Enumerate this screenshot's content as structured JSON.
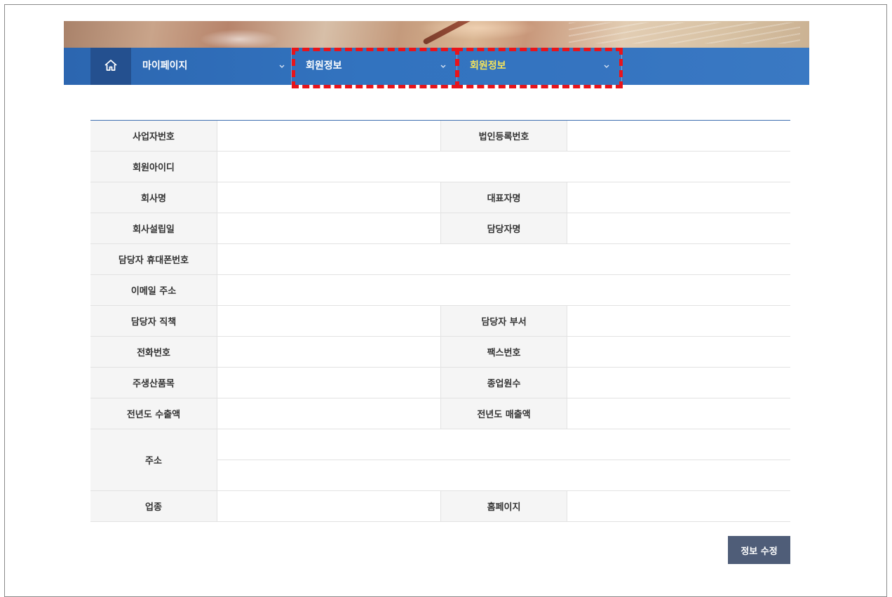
{
  "nav": {
    "home_icon": "home-icon",
    "items": [
      {
        "label": "마이페이지",
        "icon": "chevron-down-icon"
      },
      {
        "label": "회원정보",
        "icon": "chevron-down-icon"
      },
      {
        "label": "회원정보",
        "icon": "chevron-down-icon",
        "active": true
      }
    ],
    "active_color": "#f7e55a",
    "bar_color": "#3273bf",
    "home_bg": "#24508f"
  },
  "highlight_color": "#e8141b",
  "form": {
    "rows": [
      {
        "label": "사업자번호",
        "label2": "법인등록번호"
      },
      {
        "label": "회원아이디"
      },
      {
        "label": "회사명",
        "label2": "대표자명"
      },
      {
        "label": "회사설립일",
        "label2": "담당자명"
      },
      {
        "label": "담당자 휴대폰번호"
      },
      {
        "label": "이메일 주소"
      },
      {
        "label": "담당자 직책",
        "label2": "담당자 부서"
      },
      {
        "label": "전화번호",
        "label2": "팩스번호"
      },
      {
        "label": "주생산품목",
        "label2": "종업원수"
      },
      {
        "label": "전년도 수출액",
        "label2": "전년도 매출액"
      },
      {
        "label": "주소"
      },
      {
        "label": "업종",
        "label2": "홈페이지"
      }
    ]
  },
  "actions": {
    "edit_label": "정보 수정"
  }
}
